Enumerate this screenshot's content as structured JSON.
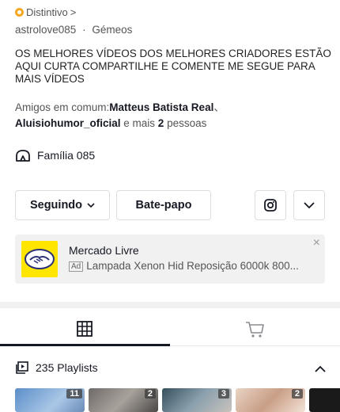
{
  "badge": {
    "label": "Distintivo",
    "chevron": ">"
  },
  "profile": {
    "handle": "astrolove085",
    "separator": "·",
    "sign": "Gémeos"
  },
  "bio": "OS MELHORES VÍDEOS DOS MELHORES CRIADORES ESTÃO AQUI CURTA COMPARTILHE E COMENTE ME SEGUE PARA MAIS VÍDEOS",
  "friends": {
    "prefix": "Amigos em comum:",
    "friend1": "Matteus Batista Real",
    "sep": "、",
    "friend2": "Aluisiohumor_oficial",
    "middle": " e mais ",
    "count": "2",
    "suffix": " pessoas"
  },
  "family": {
    "label": "Família 085",
    "icon": "family-icon"
  },
  "actions": {
    "following": "Seguindo",
    "chat": "Bate-papo",
    "instagram_icon": "instagram-icon",
    "more_icon": "chevron-down-icon"
  },
  "ad": {
    "title": "Mercado Livre",
    "tag": "Ad",
    "text": "Lampada Xenon Hid Reposição 6000k 800...",
    "close": "×",
    "brand_color": "#ffe600"
  },
  "tabs": [
    {
      "icon": "grid-icon"
    },
    {
      "icon": "cart-icon"
    }
  ],
  "playlists": {
    "label": "235 Playlists",
    "icon": "playlist-icon"
  },
  "thumbnails": [
    {
      "count": "11"
    },
    {
      "count": "2"
    },
    {
      "count": "3"
    },
    {
      "count": "2"
    }
  ]
}
